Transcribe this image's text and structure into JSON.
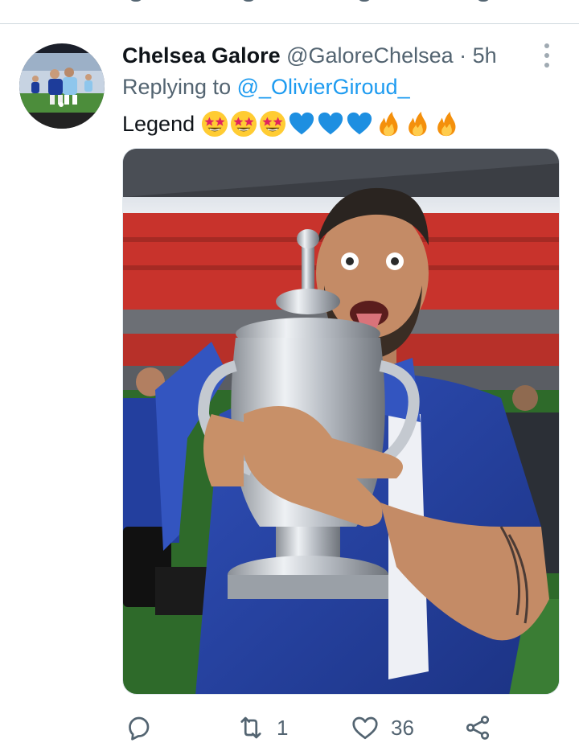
{
  "tweet": {
    "display_name": "Chelsea Galore",
    "handle": "@GaloreChelsea",
    "separator": "·",
    "time": "5h",
    "reply_prefix": "Replying to",
    "reply_to": "@_OlivierGiroud_",
    "text": "Legend",
    "emojis": [
      "star-struck-emoji",
      "star-struck-emoji",
      "star-struck-emoji",
      "blue-heart-emoji",
      "blue-heart-emoji",
      "blue-heart-emoji",
      "fire-emoji",
      "fire-emoji",
      "fire-emoji"
    ],
    "media_description_icon": "photo",
    "actions": {
      "reply_count": "",
      "retweet_count": "1",
      "like_count": "36"
    }
  },
  "colors": {
    "accent": "#1d9bf0",
    "secondary_text": "#536471",
    "primary_text": "#0f1419",
    "chelsea_blue": "#2a4bb0"
  }
}
